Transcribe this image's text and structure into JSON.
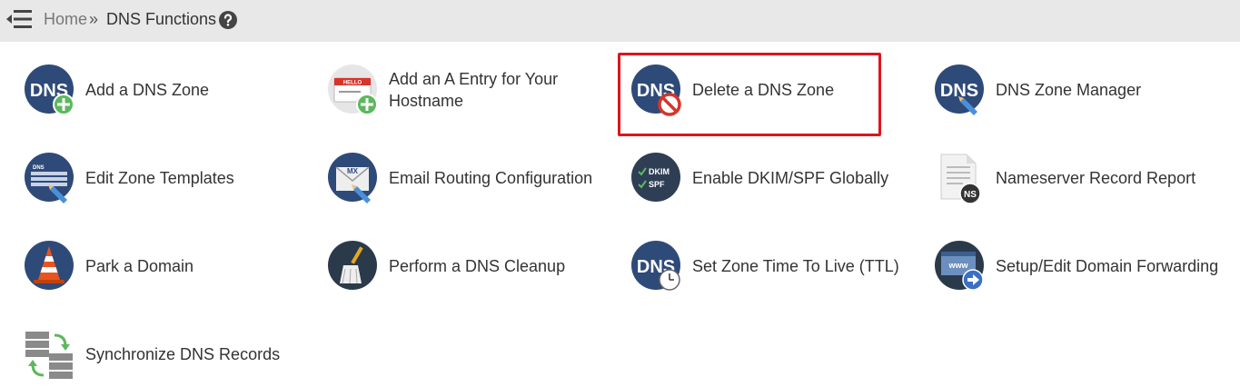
{
  "breadcrumb": {
    "home": "Home",
    "separator": "»",
    "current": "DNS Functions"
  },
  "icons": {
    "menu": "menu-collapse-icon",
    "help": "question-circle-icon"
  },
  "tools": [
    {
      "label": "Add a DNS Zone",
      "icon": "dns-add-icon"
    },
    {
      "label": "Add an A Entry for Your Hostname",
      "icon": "hello-badge-add-icon"
    },
    {
      "label": "Delete a DNS Zone",
      "icon": "dns-delete-icon"
    },
    {
      "label": "DNS Zone Manager",
      "icon": "dns-edit-icon"
    },
    {
      "label": "Edit Zone Templates",
      "icon": "zone-template-edit-icon"
    },
    {
      "label": "Email Routing Configuration",
      "icon": "mx-envelope-icon"
    },
    {
      "label": "Enable DKIM/SPF Globally",
      "icon": "dkim-spf-icon"
    },
    {
      "label": "Nameserver Record Report",
      "icon": "ns-report-icon"
    },
    {
      "label": "Park a Domain",
      "icon": "traffic-cone-icon"
    },
    {
      "label": "Perform a DNS Cleanup",
      "icon": "broom-icon"
    },
    {
      "label": "Set Zone Time To Live (TTL)",
      "icon": "dns-clock-icon"
    },
    {
      "label": "Setup/Edit Domain Forwarding",
      "icon": "www-forward-icon"
    },
    {
      "label": "Synchronize DNS Records",
      "icon": "server-sync-icon"
    }
  ],
  "dkim_icon_text": {
    "line1": "DKIM",
    "line2": "SPF"
  },
  "mx_icon_text": "MX",
  "ns_icon_text": "NS",
  "www_icon_text": "www",
  "dns_icon_text": "DNS",
  "hello_icon_text": "HELLO",
  "colors": {
    "topbar": "#e8e8e8",
    "icon_circle": "#2e4a78",
    "highlight": "#e0141b",
    "add_green": "#5cb85c"
  }
}
